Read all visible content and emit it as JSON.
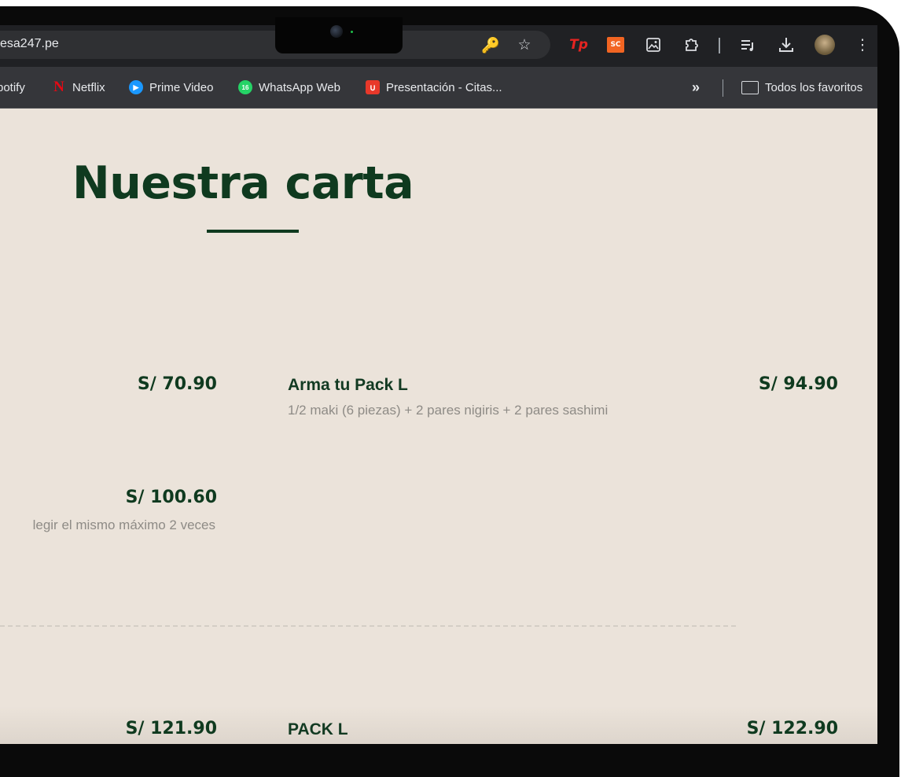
{
  "browser": {
    "url": "esa247.pe",
    "toolbar_icons": [
      "key-icon",
      "star-icon",
      "tp-extension-icon",
      "sc-extension-icon",
      "image-extension-icon",
      "extensions-puzzle-icon",
      "reading-list-icon",
      "download-icon",
      "profile-avatar",
      "more-menu-icon"
    ],
    "extension_labels": {
      "tp": "Tp",
      "sc": "SC"
    },
    "bookmarks": [
      {
        "label": "potify",
        "icon": "spotify-icon"
      },
      {
        "label": "Netflix",
        "icon": "netflix-icon",
        "glyph": "N"
      },
      {
        "label": "Prime Video",
        "icon": "prime-video-icon"
      },
      {
        "label": "WhatsApp Web",
        "icon": "whatsapp-icon",
        "glyph": "16"
      },
      {
        "label": "Presentación - Citas...",
        "icon": "upc-icon"
      }
    ],
    "overflow_label": "»",
    "all_bookmarks_label": "Todos los favoritos"
  },
  "page": {
    "title": "Nuestra carta",
    "items": [
      {
        "name": "",
        "desc": "",
        "price": "S/ 70.90"
      },
      {
        "name": "Arma tu Pack L",
        "desc": "1/2 maki (6 piezas) + 2 pares nigiris + 2 pares sashimi",
        "price": "S/ 94.90"
      },
      {
        "name": "",
        "desc": "legir el mismo máximo 2 veces",
        "price": "S/ 100.60"
      },
      {
        "name": "",
        "desc": "",
        "price": "S/ 121.90"
      },
      {
        "name": "PACK L",
        "desc": "",
        "price": "S/ 122.90"
      }
    ]
  },
  "colors": {
    "brand_green": "#0f3a1f",
    "page_bg": "#ebe3da",
    "muted_text": "#8e8b86"
  }
}
